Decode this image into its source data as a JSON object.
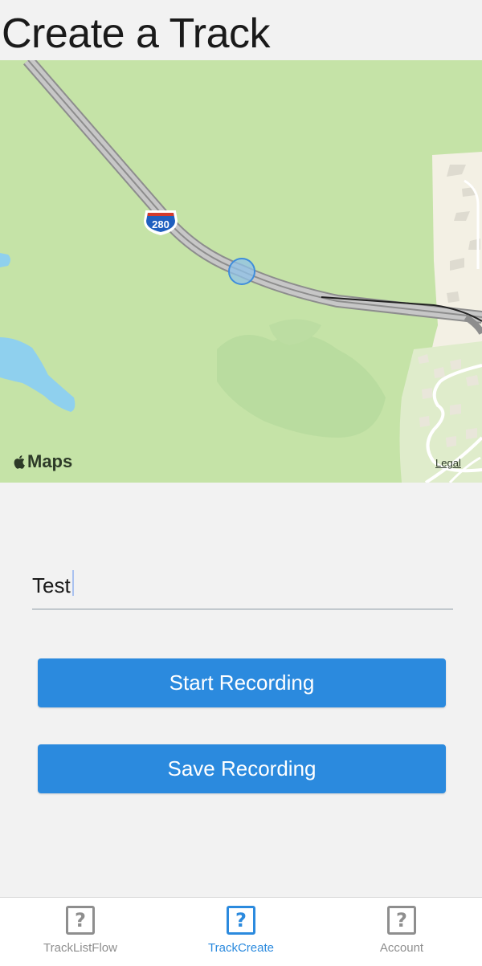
{
  "page": {
    "title": "Create a Track"
  },
  "map": {
    "logo_text": "Maps",
    "legal_label": "Legal",
    "shield_text": "280",
    "location_icon": "user-location-icon"
  },
  "form": {
    "name_value": "Test"
  },
  "buttons": {
    "start_label": "Start Recording",
    "save_label": "Save Recording"
  },
  "tabs": [
    {
      "label": "TrackListFlow",
      "icon": "question-mark-icon",
      "active": false
    },
    {
      "label": "TrackCreate",
      "icon": "question-mark-icon",
      "active": true
    },
    {
      "label": "Account",
      "icon": "question-mark-icon",
      "active": false
    }
  ],
  "colors": {
    "accent": "#2b8ade",
    "inactive": "#8e8e8e",
    "map_green": "#c5e3a7",
    "water": "#8fd0ee"
  }
}
